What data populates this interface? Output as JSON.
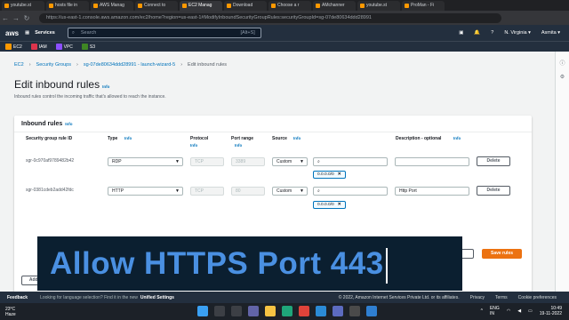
{
  "browser": {
    "tabs": [
      "youtube.st",
      "hosts file in",
      "AWS Manag",
      "Connect to",
      "EC2 Manag",
      "Download",
      "Choose a r",
      "AMchanner",
      "youtube.st",
      "ProMan - Fi"
    ],
    "active_tab": 4,
    "url": "https://us-east-1.console.aws.amazon.com/ec2/home?region=us-east-1#ModifyInboundSecurityGroupRules:securityGroupId=sg-07de80634ddd28991"
  },
  "aws_header": {
    "logo": "aws",
    "services_label": "Services",
    "search_placeholder": "Search",
    "search_shortcut": "[Alt+S]",
    "region": "N. Virginia ▾",
    "user": "Asmita ▾"
  },
  "favorites": [
    {
      "label": "EC2",
      "color": "#ff9900"
    },
    {
      "label": "IAM",
      "color": "#dd344c"
    },
    {
      "label": "VPC",
      "color": "#8c4fff"
    },
    {
      "label": "S3",
      "color": "#3f8624"
    }
  ],
  "breadcrumb": [
    "EC2",
    "Security Groups",
    "sg-07de80634ddd28991 - launch-wizard-5",
    "Edit inbound rules"
  ],
  "page": {
    "title": "Edit inbound rules",
    "info": "Info",
    "description": "Inbound rules control the incoming traffic that's allowed to reach the instance."
  },
  "panel": {
    "title": "Inbound rules",
    "info": "Info",
    "columns": {
      "id": "Security group rule ID",
      "type": "Type",
      "type_info": "Info",
      "protocol": "Protocol",
      "protocol_info": "Info",
      "port": "Port range",
      "port_info": "Info",
      "source": "Source",
      "source_info": "Info",
      "desc": "Description - optional",
      "desc_info": "Info"
    },
    "rows": [
      {
        "id": "sgr-0c970af9789482b42",
        "type": "RDP",
        "protocol": "TCP",
        "port": "3389",
        "source": "Custom",
        "cidr": "0.0.0.0/0",
        "description": "",
        "delete": "Delete"
      },
      {
        "id": "sgr-0381cdeb2add42fdc",
        "type": "HTTP",
        "protocol": "TCP",
        "port": "80",
        "source": "Custom",
        "cidr": "0.0.0.0/0",
        "description": "Http Port",
        "delete": "Delete"
      }
    ],
    "add_rule": "Add rule"
  },
  "overlay_text": "Allow HTTPS Port 443",
  "actions": {
    "preview": "ges",
    "save": "Save rules"
  },
  "footer": {
    "feedback": "Feedback",
    "lang_text": "Looking for language selection? Find it in the new",
    "unified": "Unified Settings",
    "copyright": "© 2022, Amazon Internet Services Private Ltd. or its affiliates.",
    "privacy": "Privacy",
    "terms": "Terms",
    "cookie": "Cookie preferences"
  },
  "taskbar": {
    "temp": "23°C",
    "weather": "Haze",
    "lang": "ENG",
    "region": "IN",
    "time": "10:49",
    "date": "19-11-2022"
  }
}
